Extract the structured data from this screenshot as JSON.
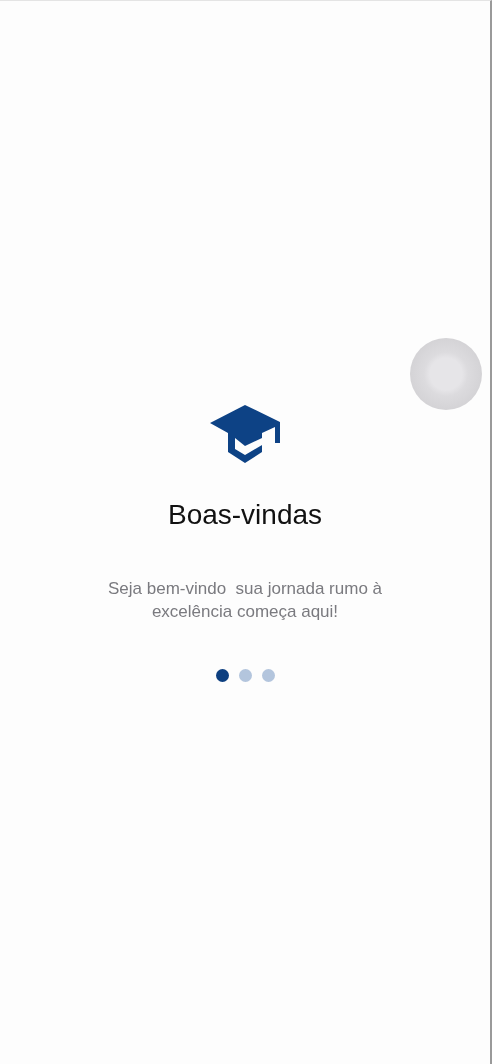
{
  "onboarding": {
    "title": "Boas-vindas",
    "description": "Seja bem-vindo  sua jornada rumo à excelência começa aqui!"
  },
  "pager": [
    {
      "selected": true
    },
    {
      "selected": false
    },
    {
      "selected": false
    }
  ]
}
